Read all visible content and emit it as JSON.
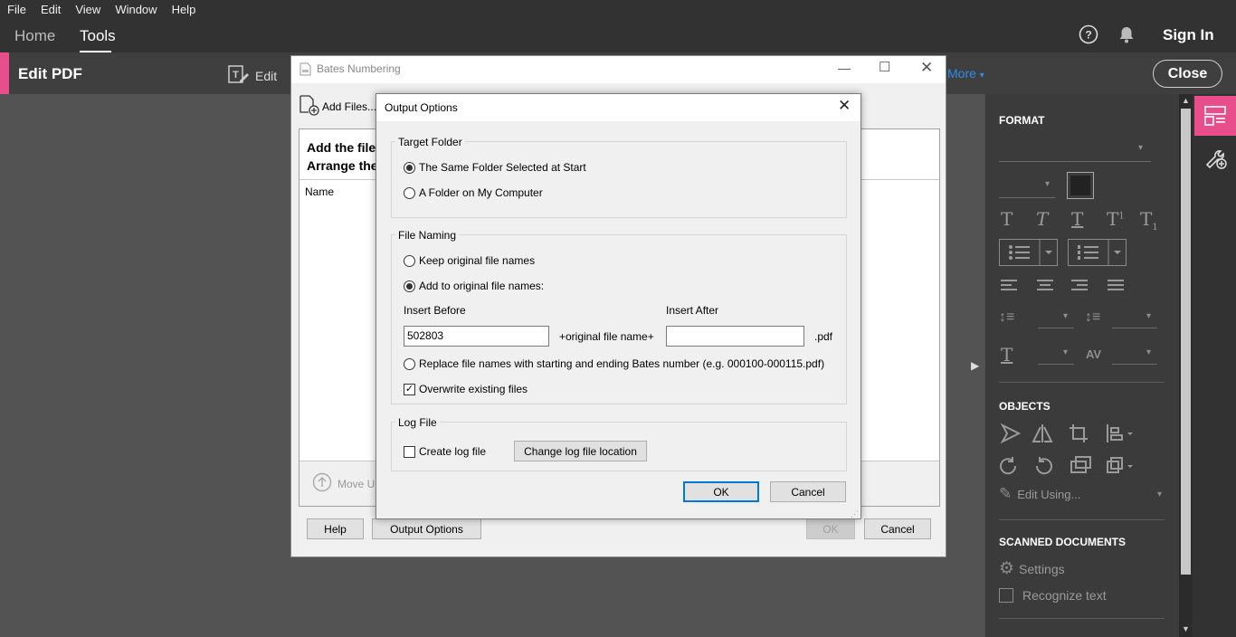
{
  "menubar": {
    "items": [
      "File",
      "Edit",
      "View",
      "Window",
      "Help"
    ]
  },
  "topnav": {
    "home": "Home",
    "tools": "Tools",
    "sign_in": "Sign In"
  },
  "toolbar": {
    "title": "Edit PDF",
    "edit_label": "Edit",
    "more_label": "More",
    "close_label": "Close"
  },
  "right_panel": {
    "format_header": "FORMAT",
    "objects_header": "OBJECTS",
    "edit_using_label": "Edit Using...",
    "scanned_header": "SCANNED DOCUMENTS",
    "settings_label": "Settings",
    "recognize_text_label": "Recognize text"
  },
  "bates_dialog": {
    "title": "Bates Numbering",
    "add_files_label": "Add Files...",
    "instruction_line1": "Add the files",
    "instruction_line2": "Arrange the",
    "name_header": "Name",
    "move_up_label": "Move Up",
    "help_label": "Help",
    "output_options_label": "Output Options",
    "ok_label": "OK",
    "cancel_label": "Cancel"
  },
  "output_options_dialog": {
    "title": "Output Options",
    "target_folder": {
      "label": "Target Folder",
      "same_folder_label": "The Same Folder Selected at Start",
      "my_computer_label": "A Folder on My Computer"
    },
    "file_naming": {
      "label": "File Naming",
      "keep_original_label": "Keep original file names",
      "add_to_original_label": "Add to original file names:",
      "insert_before_label": "Insert Before",
      "insert_before_value": "502803",
      "original_name_label": "+original file name+",
      "insert_after_label": "Insert After",
      "insert_after_value": "",
      "pdf_ext_label": ".pdf",
      "replace_label": "Replace file names with starting and ending Bates number (e.g. 000100-000115.pdf)",
      "overwrite_label": "Overwrite existing files",
      "overwrite_checkmark": "✓"
    },
    "log_file": {
      "label": "Log File",
      "create_log_label": "Create log file",
      "change_location_label": "Change log file location"
    },
    "ok_label": "OK",
    "cancel_label": "Cancel"
  },
  "colors": {
    "accent_pink": "#e94e8c",
    "link_blue": "#2d8ceb",
    "default_button_border": "#0078d7"
  },
  "icons": [
    "help-icon",
    "bell-icon",
    "edit-text-icon",
    "document-icon",
    "add-file-icon",
    "arrow-up-circle-icon",
    "close-icon",
    "minimize-icon",
    "maximize-icon",
    "gear-icon",
    "pencil-icon",
    "wrench-plus-icon",
    "panel-icon",
    "collapse-arrow-icon"
  ]
}
